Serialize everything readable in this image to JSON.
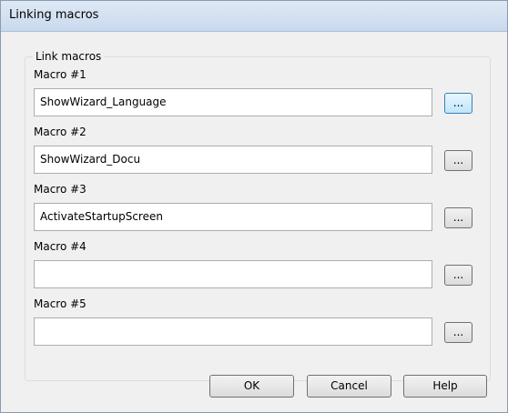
{
  "window": {
    "title": "Linking macros"
  },
  "group": {
    "label": "Link macros"
  },
  "macros": [
    {
      "label": "Macro #1",
      "value": "ShowWizard_Language",
      "browse_label": "..."
    },
    {
      "label": "Macro #2",
      "value": "ShowWizard_Docu",
      "browse_label": "..."
    },
    {
      "label": "Macro #3",
      "value": "ActivateStartupScreen",
      "browse_label": "..."
    },
    {
      "label": "Macro #4",
      "value": "",
      "browse_label": "..."
    },
    {
      "label": "Macro #5",
      "value": "",
      "browse_label": "..."
    }
  ],
  "buttons": {
    "ok": "OK",
    "cancel": "Cancel",
    "help": "Help"
  }
}
